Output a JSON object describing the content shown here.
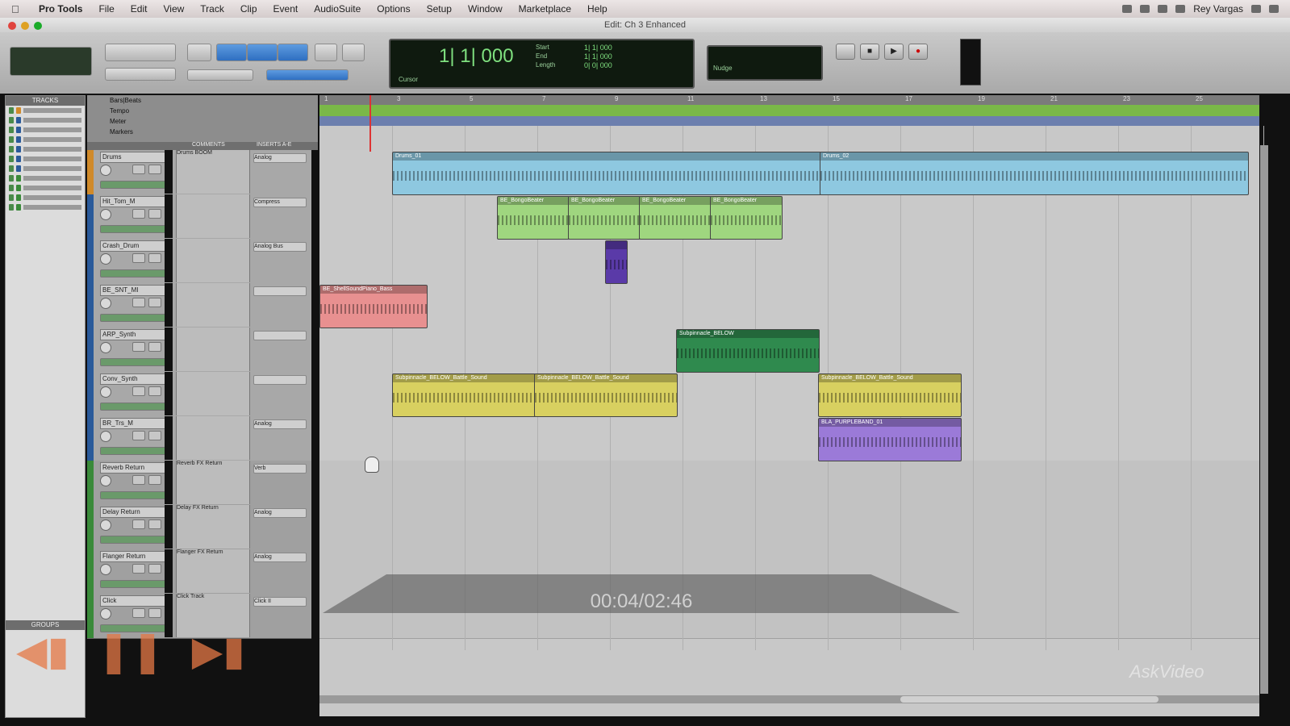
{
  "menubar": {
    "app": "Pro Tools",
    "items": [
      "File",
      "Edit",
      "View",
      "Track",
      "Clip",
      "Event",
      "AudioSuite",
      "Options",
      "Setup",
      "Window",
      "Marketplace",
      "Help"
    ],
    "user": "Rey Vargas"
  },
  "window": {
    "title": "Edit: Ch 3 Enhanced"
  },
  "counter": {
    "main": "1| 1| 000",
    "start_label": "Start",
    "start": "1| 1| 000",
    "end_label": "End",
    "end": "1| 1| 000",
    "length_label": "Length",
    "length": "0| 0| 000",
    "cursor_label": "Cursor",
    "nudge_label": "Nudge"
  },
  "panels": {
    "tracks_label": "TRACKS",
    "groups_label": "GROUPS",
    "rulers": [
      "Bars|Beats",
      "Tempo",
      "Meter",
      "Markers"
    ],
    "comments_header": "COMMENTS",
    "io_header": "INSERTS A-E"
  },
  "tracks": [
    {
      "name": "Drums",
      "comment": "Drums BOOM",
      "color": "#d08a2a",
      "io": "Analog"
    },
    {
      "name": "Hit_Tom_M",
      "comment": "",
      "color": "#2a5a9a",
      "io": "Compress"
    },
    {
      "name": "Crash_Drum",
      "comment": "",
      "color": "#2a5a9a",
      "io": "Analog Bus"
    },
    {
      "name": "BE_SNT_MI",
      "comment": "",
      "color": "#2a5a9a",
      "io": ""
    },
    {
      "name": "ARP_Synth",
      "comment": "",
      "color": "#2a5a9a",
      "io": ""
    },
    {
      "name": "Conv_Synth",
      "comment": "",
      "color": "#2a5a9a",
      "io": ""
    },
    {
      "name": "BR_Trs_M",
      "comment": "",
      "color": "#2a5a9a",
      "io": "Analog"
    },
    {
      "name": "Reverb Return",
      "comment": "Reverb FX Return",
      "color": "#3a8a3a",
      "io": "Verb"
    },
    {
      "name": "Delay Return",
      "comment": "Delay FX Return",
      "color": "#3a8a3a",
      "io": "Analog"
    },
    {
      "name": "Flanger Return",
      "comment": "Flanger FX Return",
      "color": "#3a8a3a",
      "io": "Analog"
    },
    {
      "name": "Click",
      "comment": "Click Track",
      "color": "#3a8a3a",
      "io": "Click II"
    }
  ],
  "ruler_ticks": [
    "1",
    "3",
    "5",
    "7",
    "9",
    "11",
    "13",
    "15",
    "17",
    "19",
    "21",
    "23",
    "25"
  ],
  "clips": [
    {
      "title": "Drums_01",
      "color": "#8ec8e0"
    },
    {
      "title": "Drums_02",
      "color": "#8ec8e0"
    },
    {
      "title": "BE_BongoBeater",
      "color": "#9fd67f"
    },
    {
      "title": "BE_BongoBeater",
      "color": "#9fd67f"
    },
    {
      "title": "BE_BongoBeater",
      "color": "#9fd67f"
    },
    {
      "title": "BE_BongoBeater",
      "color": "#9fd67f"
    },
    {
      "title": "",
      "color": "#5a3aa8"
    },
    {
      "title": "BE_ShellSoundPiano_Bass",
      "color": "#e89090"
    },
    {
      "title": "Subpinnacle_BELOW",
      "color": "#2f8a4e"
    },
    {
      "title": "Subpinnacle_BELOW_Battle_Sound",
      "color": "#d8d060"
    },
    {
      "title": "Subpinnacle_BELOW_Battle_Sound",
      "color": "#d8d060"
    },
    {
      "title": "Subpinnacle_BELOW_Battle_Sound",
      "color": "#d8d060"
    },
    {
      "title": "BLA_PURPLEBAND_01",
      "color": "#9b7ad8"
    }
  ],
  "video": {
    "time": "00:04/02:46",
    "watermark": "AskVideo"
  }
}
